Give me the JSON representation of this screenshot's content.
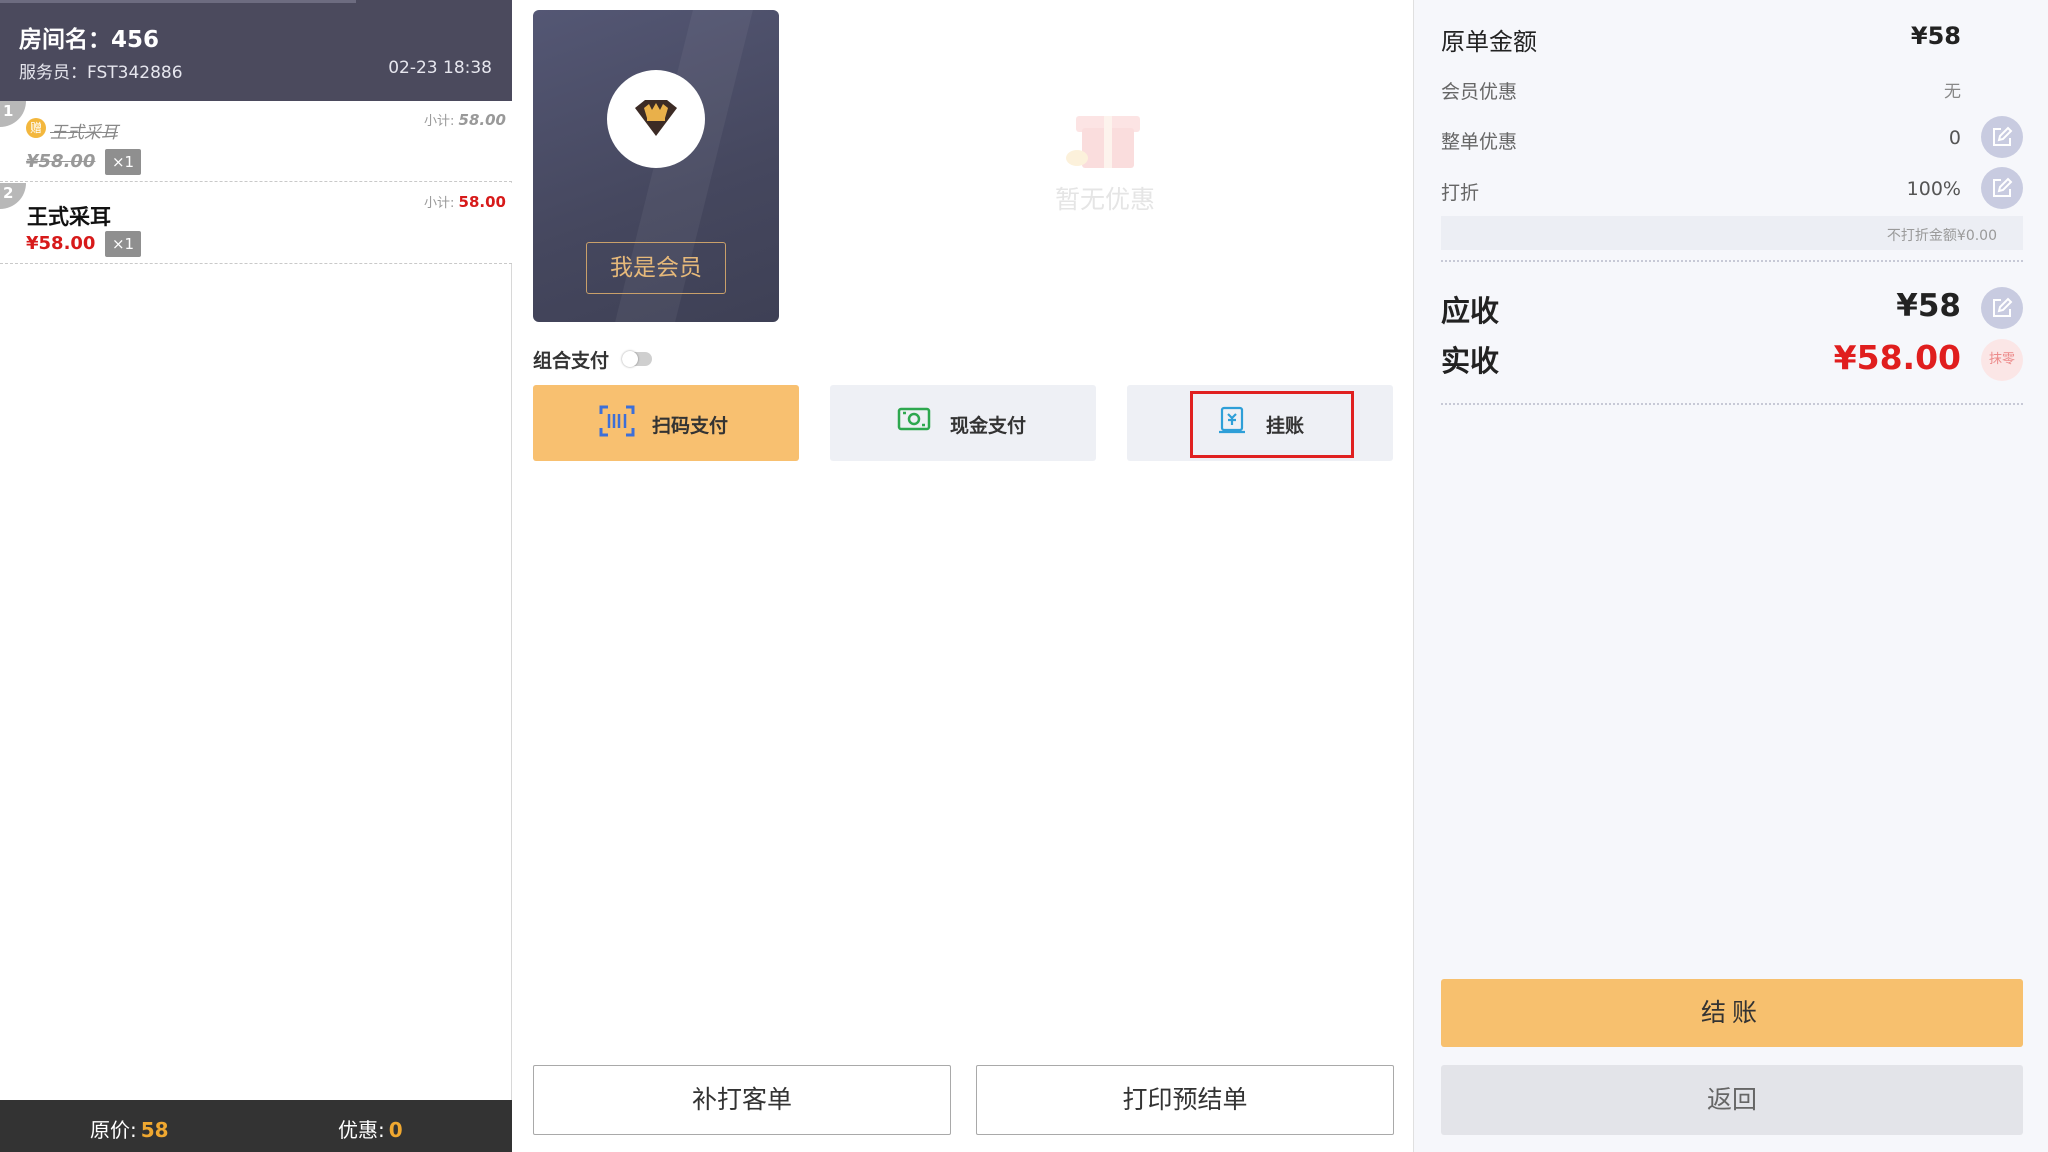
{
  "room": {
    "name": "房间名：456",
    "waiter": "服务员：FST342886",
    "datetime": "02-23 18:38"
  },
  "order_items": [
    {
      "index": "1",
      "name": "王式采耳",
      "price": "¥58.00",
      "qty": "×1",
      "subtotal_label": "小计:",
      "subtotal": "58.00",
      "gift": true,
      "gift_icon": "gift-coin-icon"
    },
    {
      "index": "2",
      "name": "王式采耳",
      "price": "¥58.00",
      "qty": "×1",
      "subtotal_label": "小计:",
      "subtotal": "58.00",
      "gift": false
    }
  ],
  "left_footer": {
    "orig_label": "原价:",
    "orig_value": "58",
    "discount_label": "优惠:",
    "discount_value": "0"
  },
  "member": {
    "button_label": "我是会员",
    "avatar_icon": "crown-diamond-icon"
  },
  "promotion": {
    "empty_text": "暂无优惠",
    "icon": "gift-box-icon"
  },
  "combo_pay": {
    "label": "组合支付",
    "enabled": false
  },
  "payment_methods": [
    {
      "label": "扫码支付",
      "icon": "scan-code-icon",
      "active": true
    },
    {
      "label": "现金支付",
      "icon": "cash-icon",
      "active": false
    },
    {
      "label": "挂账",
      "icon": "credit-account-icon",
      "active": false,
      "highlighted": true
    }
  ],
  "bottom_actions": {
    "reprint_label": "补打客单",
    "preprint_label": "打印预结单"
  },
  "summary": {
    "original_label": "原单金额",
    "original_value": "¥58",
    "member_discount_label": "会员优惠",
    "member_discount_value": "无",
    "whole_discount_label": "整单优惠",
    "whole_discount_value": "0",
    "rate_label": "打折",
    "rate_value": "100%",
    "no_discount_amount": "不打折金额¥0.00",
    "receivable_label": "应收",
    "receivable_value": "¥58",
    "received_label": "实收",
    "received_value": "¥58.00",
    "round_off_label": "抹零"
  },
  "actions": {
    "checkout_label": "结账",
    "back_label": "返回"
  },
  "colors": {
    "accent_orange": "#f8c070",
    "price_red": "#d71a1a",
    "header_dark": "#4b4a5d",
    "highlight_red": "#e02020"
  }
}
